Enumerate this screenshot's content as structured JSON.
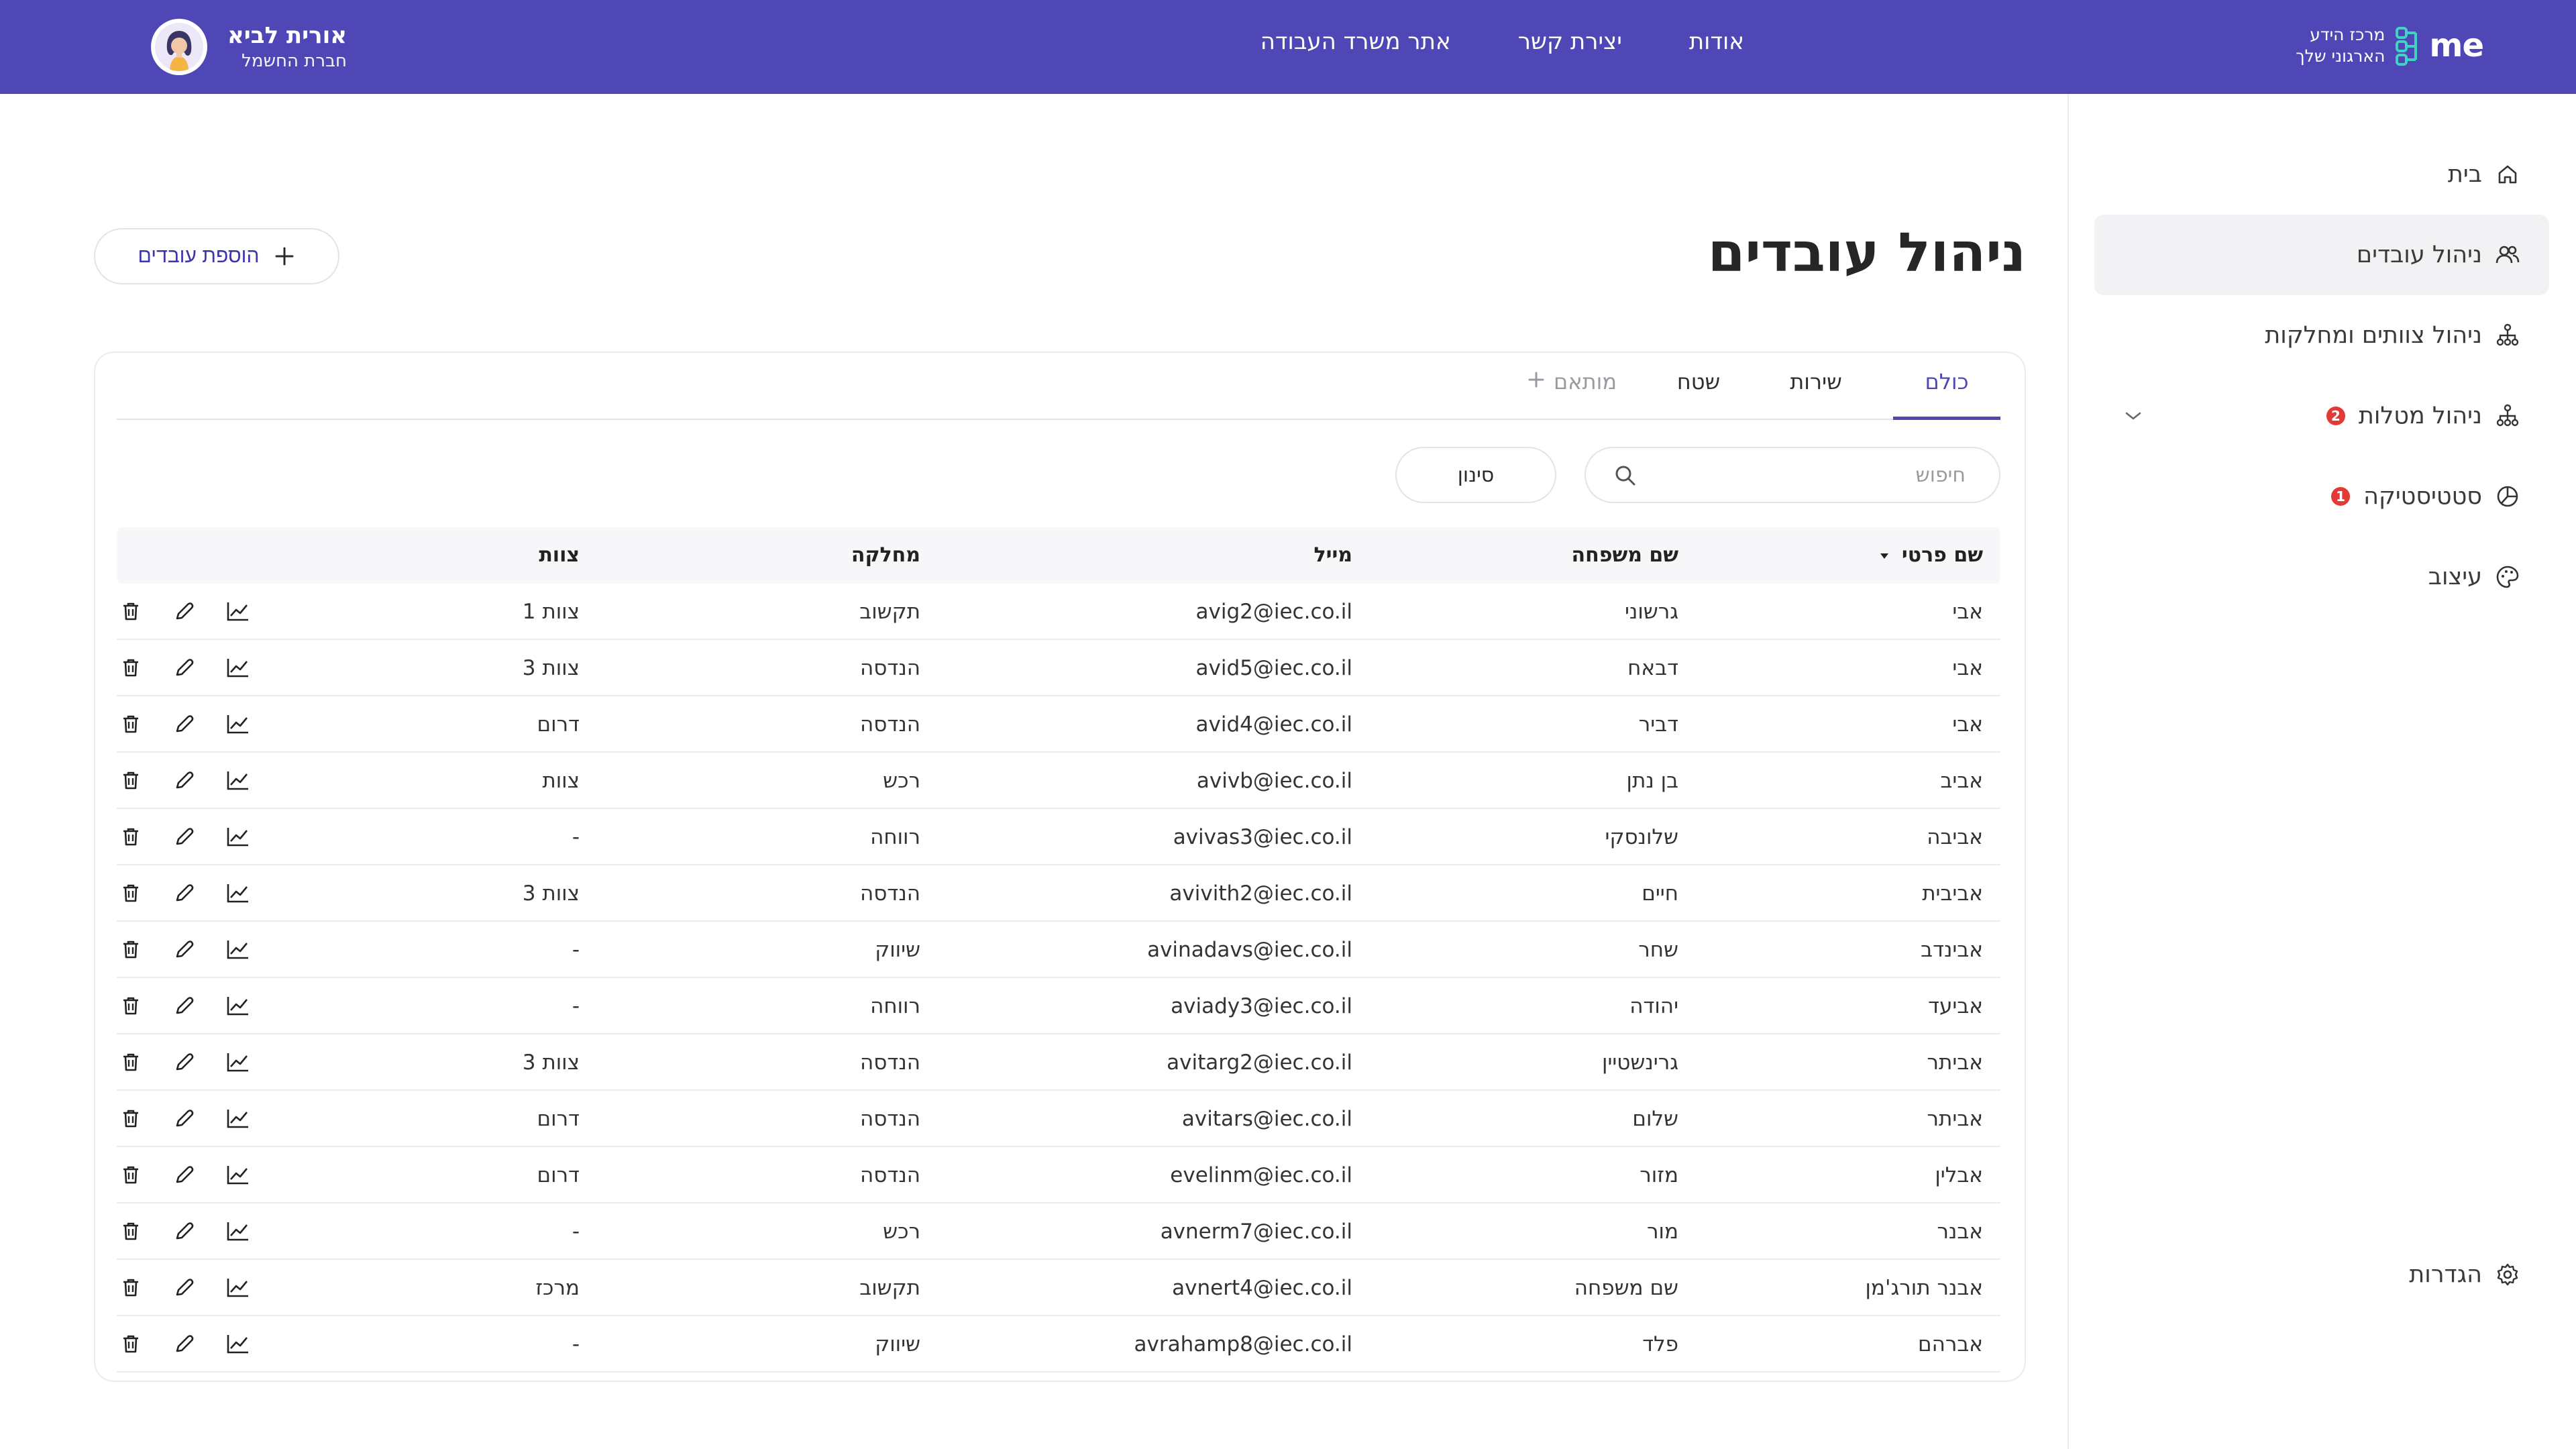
{
  "header": {
    "logo_text_line1": "מרכז הידע",
    "logo_text_line2": "הארגוני שלך",
    "logo_mark": "me",
    "nav": [
      "אודות",
      "יצירת קשר",
      "אתר משרד העבודה"
    ],
    "user_name": "אורית לביא",
    "user_company": "חברת החשמל"
  },
  "sidebar": {
    "items": [
      {
        "label": "בית",
        "icon": "home-icon"
      },
      {
        "label": "ניהול עובדים",
        "icon": "users-icon"
      },
      {
        "label": "ניהול צוותים ומחלקות",
        "icon": "org-chart-icon"
      },
      {
        "label": "ניהול מטלות",
        "icon": "tasks-tree-icon",
        "badge": "2"
      },
      {
        "label": "סטטיסטיקה",
        "icon": "stats-icon",
        "badge": "1"
      },
      {
        "label": "עיצוב",
        "icon": "palette-icon"
      }
    ],
    "settings_label": "הגדרות",
    "colors": {
      "badge": "#e53935",
      "active_bg": "#f2f2f5"
    }
  },
  "main": {
    "title": "ניהול עובדים",
    "add_button_label": "הוספת עובדים",
    "tabs": [
      "כולם",
      "שירות",
      "שטח",
      "מותאם"
    ],
    "search_placeholder": "חיפוש",
    "filter_label": "סינון",
    "columns": [
      "שם פרטי",
      "שם משפחה",
      "מייל",
      "מחלקה",
      "צוות"
    ],
    "rows": [
      {
        "first": "אבי",
        "last": "גרשוני",
        "email": "avig2@iec.co.il",
        "dept": "תקשוב",
        "team": "צוות 1"
      },
      {
        "first": "אבי",
        "last": "דבאח",
        "email": "avid5@iec.co.il",
        "dept": "הנדסה",
        "team": "צוות 3"
      },
      {
        "first": "אבי",
        "last": "דביר",
        "email": "avid4@iec.co.il",
        "dept": "הנדסה",
        "team": "דרום"
      },
      {
        "first": "אביב",
        "last": "בן נתן",
        "email": "avivb@iec.co.il",
        "dept": "רכש",
        "team": "צוות"
      },
      {
        "first": "אביבה",
        "last": "שלונסקי",
        "email": "avivas3@iec.co.il",
        "dept": "רווחה",
        "team": "-"
      },
      {
        "first": "אביבית",
        "last": "חיים",
        "email": "avivith2@iec.co.il",
        "dept": "הנדסה",
        "team": "צוות 3"
      },
      {
        "first": "אבינדב",
        "last": "שחר",
        "email": "avinadavs@iec.co.il",
        "dept": "שיווק",
        "team": "-"
      },
      {
        "first": "אביעד",
        "last": "יהודה",
        "email": "aviady3@iec.co.il",
        "dept": "רווחה",
        "team": "-"
      },
      {
        "first": "אביתר",
        "last": "גרינשטיין",
        "email": "avitarg2@iec.co.il",
        "dept": "הנדסה",
        "team": "צוות 3"
      },
      {
        "first": "אביתר",
        "last": "שלום",
        "email": "avitars@iec.co.il",
        "dept": "הנדסה",
        "team": "דרום"
      },
      {
        "first": "אבלין",
        "last": "מזור",
        "email": "evelinm@iec.co.il",
        "dept": "הנדסה",
        "team": "דרום"
      },
      {
        "first": "אבנר",
        "last": "מור",
        "email": "avnerm7@iec.co.il",
        "dept": "רכש",
        "team": "-"
      },
      {
        "first": "אבנר תורג'מן",
        "last": "שם משפחה",
        "email": "avnert4@iec.co.il",
        "dept": "תקשוב",
        "team": "מרכז"
      },
      {
        "first": "אברהם",
        "last": "פלד",
        "email": "avrahamp8@iec.co.il",
        "dept": "שיווק",
        "team": "-"
      }
    ],
    "row_action_icons": [
      "chart-icon",
      "edit-icon",
      "trash-icon"
    ],
    "colors": {
      "brand": "#4f47b5",
      "header_bg": "#4f47b5"
    }
  }
}
